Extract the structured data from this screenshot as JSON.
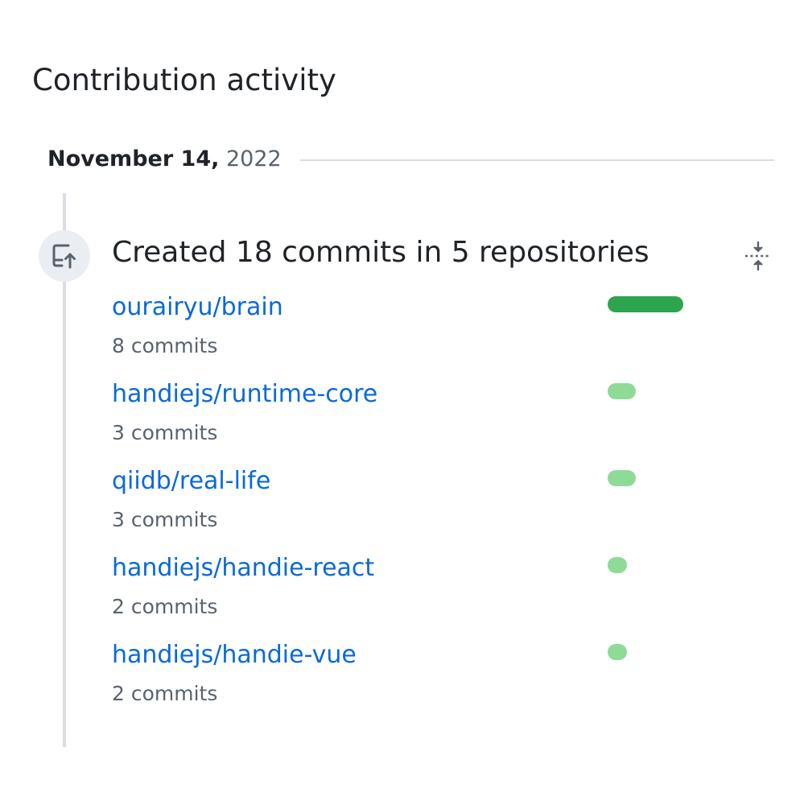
{
  "section_title": "Contribution activity",
  "date": {
    "month_day": "November 14,",
    "year": "2022"
  },
  "event": {
    "icon": "repo-push-icon",
    "title": "Created 18 commits in 5 repositories",
    "collapse_icon": "fold-icon"
  },
  "colors": {
    "link": "#0969da",
    "bar_strong": "#2da44e",
    "bar_light": "#8ddb97",
    "muted_text": "#59636e",
    "timeline": "#d8dee4"
  },
  "repositories": [
    {
      "name": "ourairyu/brain",
      "commits_label": "8 commits",
      "commits": 8
    },
    {
      "name": "handiejs/runtime-core",
      "commits_label": "3 commits",
      "commits": 3
    },
    {
      "name": "qiidb/real-life",
      "commits_label": "3 commits",
      "commits": 3
    },
    {
      "name": "handiejs/handie-react",
      "commits_label": "2 commits",
      "commits": 2
    },
    {
      "name": "handiejs/handie-vue",
      "commits_label": "2 commits",
      "commits": 2
    }
  ]
}
